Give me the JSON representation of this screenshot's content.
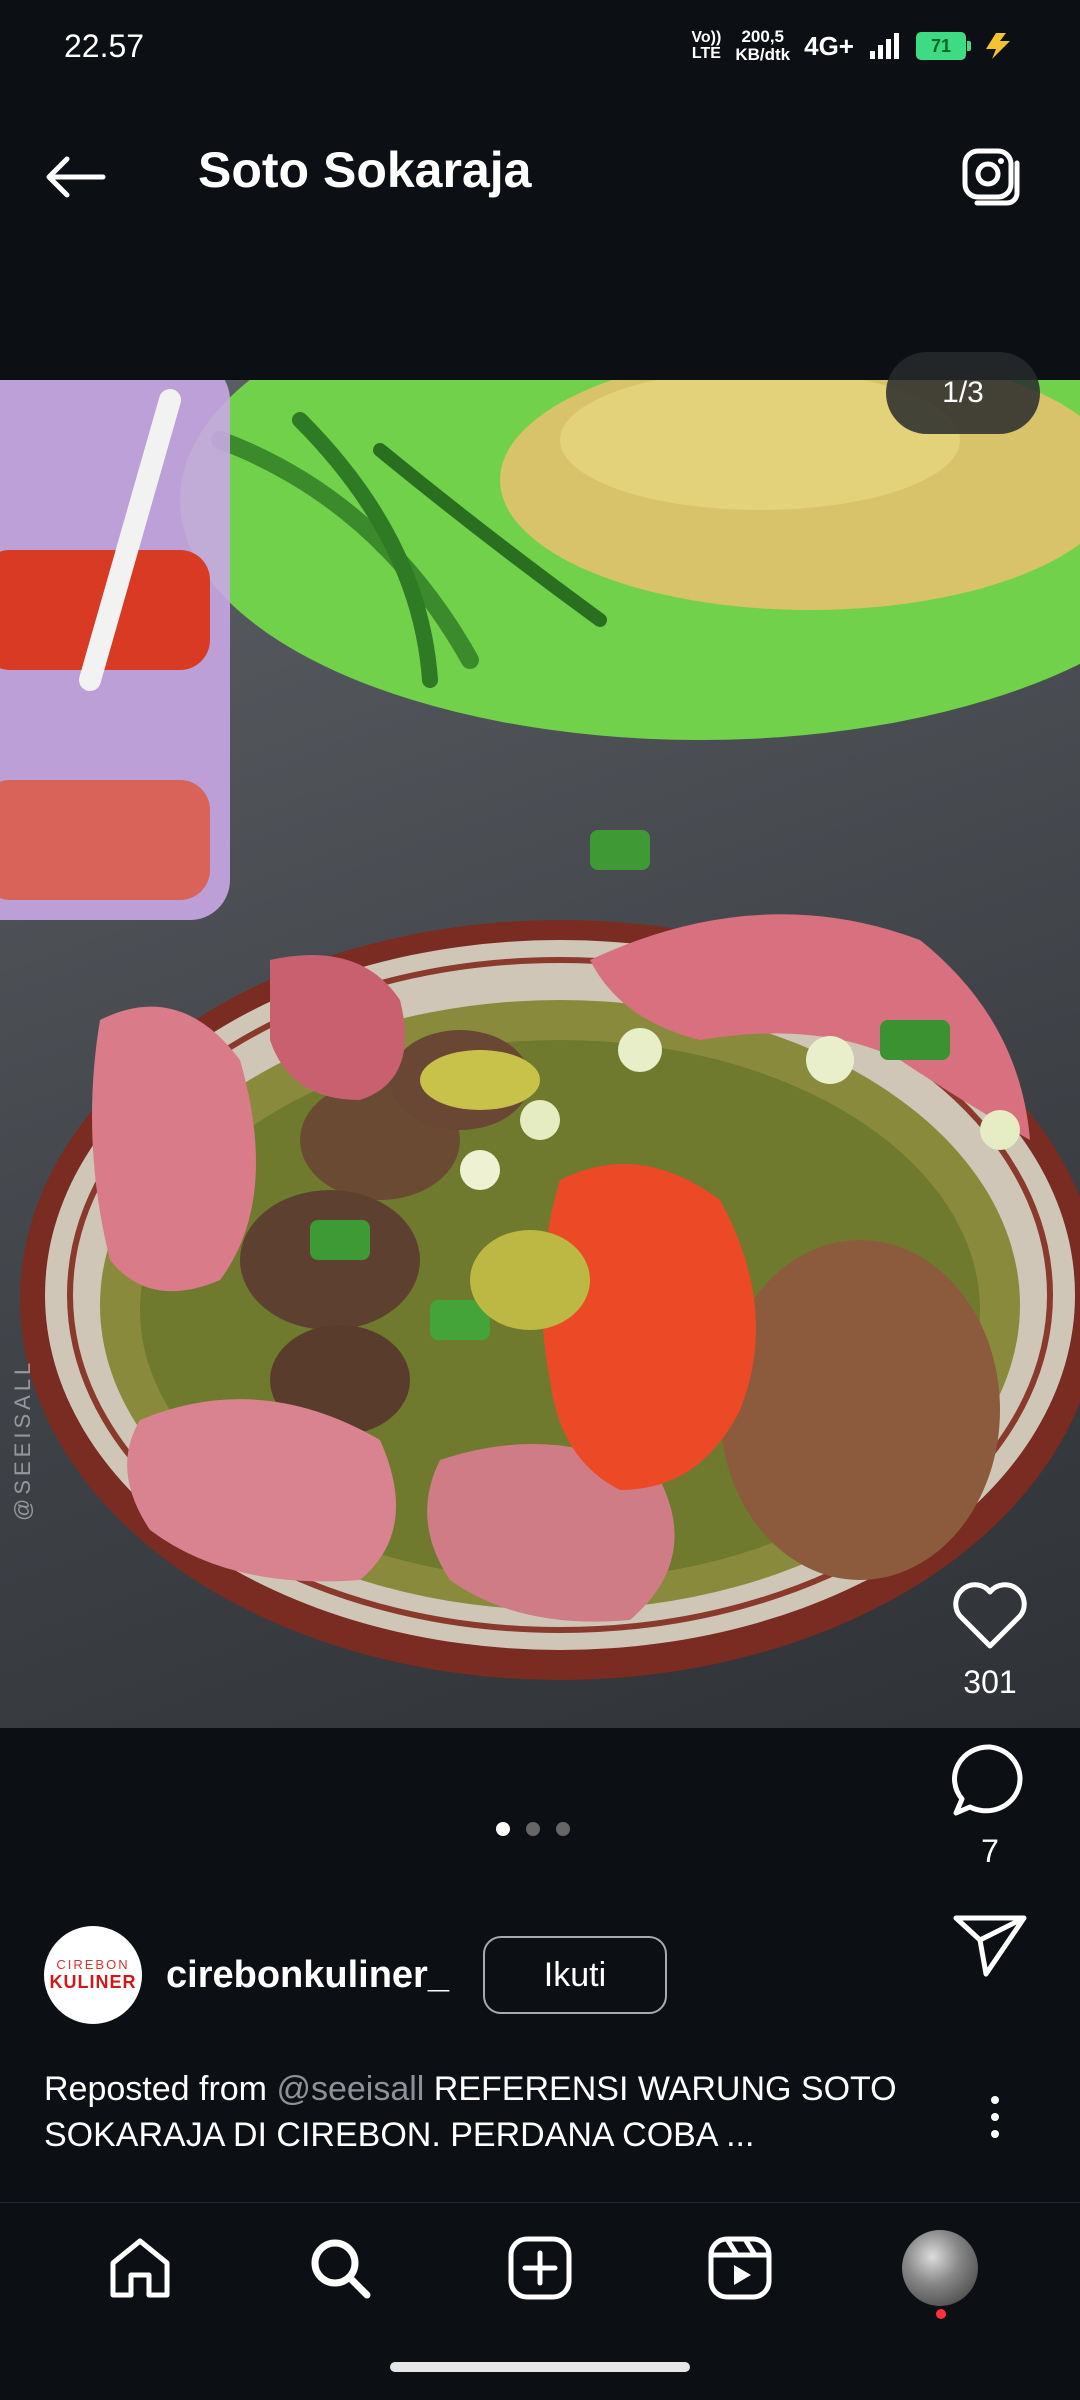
{
  "status_bar": {
    "time": "22.57",
    "volte_top": "Vo))",
    "volte_bottom": "LTE",
    "speed_value": "200,5",
    "speed_unit": "KB/dtk",
    "network": "4G+",
    "battery": "71"
  },
  "header": {
    "title": "Soto Sokaraja"
  },
  "post": {
    "image_counter": "1/3",
    "watermark": "@SEEISALL",
    "likes": "301",
    "comments": "7",
    "author": {
      "logo_line1": "CIREBON",
      "logo_line2": "KULINER",
      "username": "cirebonkuliner_",
      "follow_label": "Ikuti"
    },
    "caption": {
      "prefix": "Reposted from ",
      "mention": "@seeisall",
      "text": " REFERENSI WARUNG SOTO SOKARAJA DI CIREBON. PERDANA COBA ..."
    },
    "carousel_total": 3,
    "carousel_active": 1
  },
  "icons": {
    "back": "back-arrow-icon",
    "camera": "camera-icon",
    "like": "heart-icon",
    "comment": "comment-icon",
    "share": "send-icon",
    "more": "more-icon",
    "nav": [
      "home-icon",
      "search-icon",
      "create-icon",
      "reels-icon",
      "profile-avatar"
    ]
  },
  "colors": {
    "background": "#0c0f14",
    "battery": "#3ddc84",
    "notification": "#ff3040"
  }
}
